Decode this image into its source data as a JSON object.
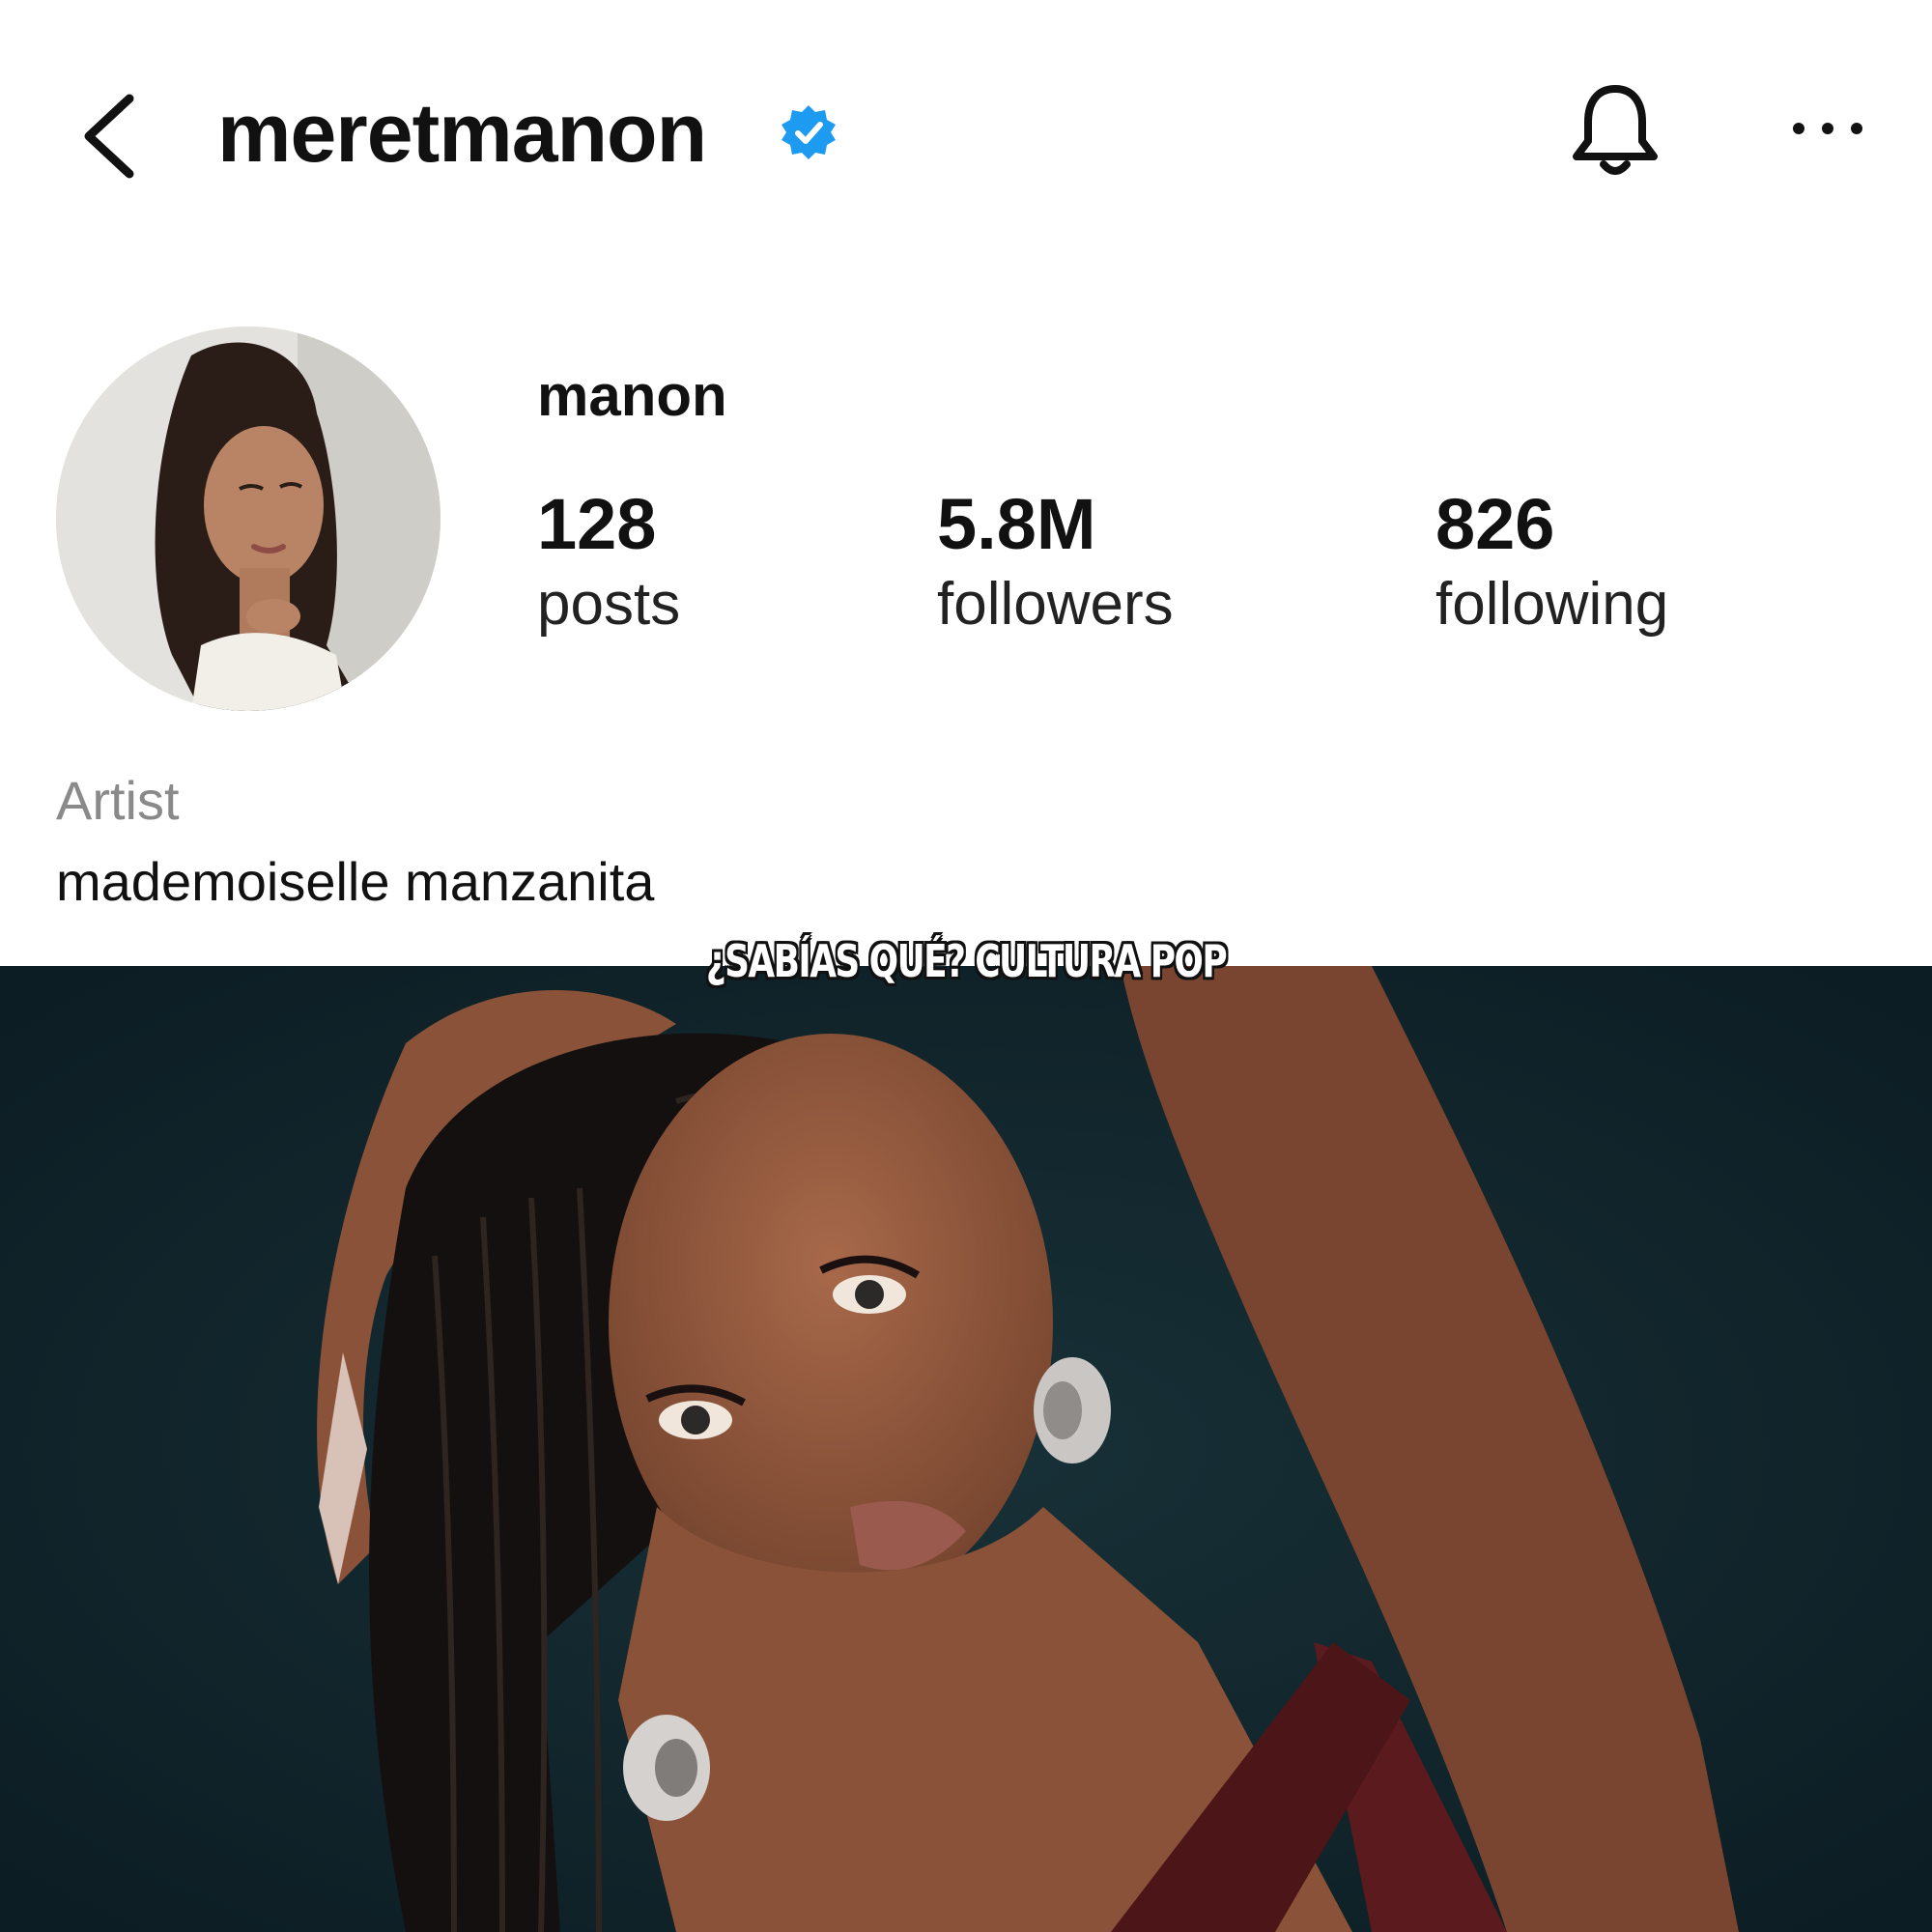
{
  "header": {
    "username": "meretmanon",
    "back_icon": "chevron-left-icon",
    "verified_icon": "verified-badge-icon",
    "verified_color": "#1d9bf0",
    "notification_icon": "bell-icon",
    "more_icon": "more-horizontal-icon"
  },
  "profile": {
    "display_name": "manon",
    "stats": {
      "posts": {
        "value": "128",
        "label": "posts"
      },
      "followers": {
        "value": "5.8M",
        "label": "followers"
      },
      "following": {
        "value": "826",
        "label": "following"
      }
    },
    "category": "Artist",
    "bio": "mademoiselle manzanita"
  },
  "photo": {
    "watermark": "¿SABÍAS QUÉ? CULTURA POP",
    "background_color": "#0f2026"
  }
}
